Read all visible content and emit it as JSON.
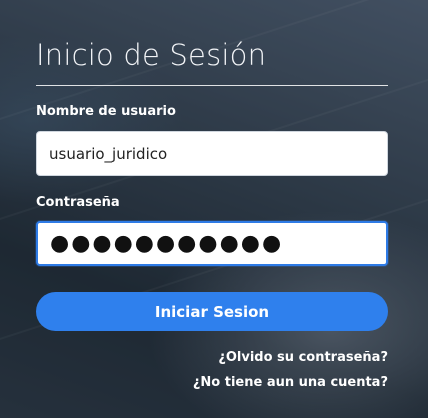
{
  "form": {
    "title": "Inicio de Sesión",
    "username": {
      "label": "Nombre de usuario",
      "value": "usuario_juridico"
    },
    "password": {
      "label": "Contraseña",
      "masked_value": "●●●●●●●●●●●"
    },
    "submit_label": "Iniciar Sesion",
    "links": {
      "forgot_password": "¿Olvido su contraseña?",
      "create_account": "¿No tiene aun una cuenta?"
    }
  },
  "colors": {
    "accent": "#2f80ed",
    "text": "#ffffff"
  }
}
